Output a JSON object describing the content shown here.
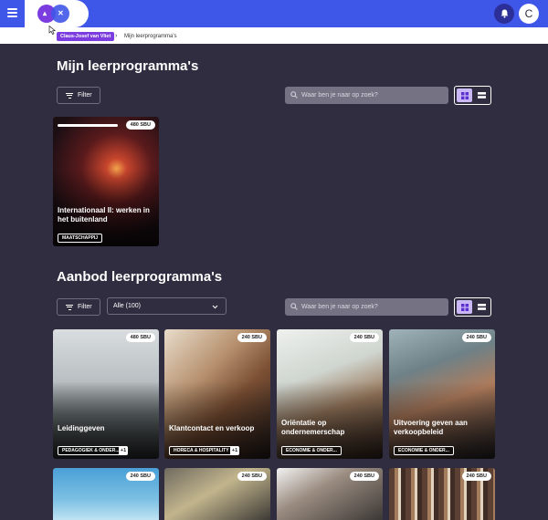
{
  "user": {
    "avatar_initial": "C",
    "name_chip": "Claus-Josef van Vliet"
  },
  "breadcrumb": {
    "separator": "›",
    "current": "Mijn leerprogramma's"
  },
  "mine": {
    "title": "Mijn leerprogramma's",
    "filter_label": "Filter",
    "search_placeholder": "Waar ben je naar op zoek?",
    "cards": [
      {
        "sbu": "480 SBU",
        "title": "Internationaal II: werken in het buitenland",
        "tag": "MAATSCHAPPIJ",
        "progress": 0.6
      }
    ]
  },
  "offer": {
    "title": "Aanbod leerprogramma's",
    "filter_label": "Filter",
    "select_value": "Alle (100)",
    "search_placeholder": "Waar ben je naar op zoek?",
    "cards": [
      {
        "sbu": "480 SBU",
        "title": "Leidinggeven",
        "tag": "PEDAGOGIEK & ONDER...",
        "more": "+1"
      },
      {
        "sbu": "240 SBU",
        "title": "Klantcontact en verkoop",
        "tag": "HORECA & HOSPITALITY",
        "more": "+1"
      },
      {
        "sbu": "240 SBU",
        "title": "Oriëntatie op ondernemerschap",
        "tag": "ECONOMIE & ONDER..."
      },
      {
        "sbu": "240 SBU",
        "title": "Uitvoering geven aan verkoopbeleid",
        "tag": "ECONOMIE & ONDER..."
      },
      {
        "sbu": "240 SBU"
      },
      {
        "sbu": "240 SBU"
      },
      {
        "sbu": "240 SBU"
      },
      {
        "sbu": "240 SBU"
      }
    ]
  },
  "colors": {
    "topbar": "#3f57e8",
    "background": "#2f2d3f",
    "accent_purple": "#7b3de0"
  },
  "icons": [
    "menu-icon",
    "logo-icon",
    "bell-icon",
    "filter-icon",
    "search-icon",
    "grid-view-icon",
    "list-view-icon",
    "chevron-down-icon",
    "cursor-icon"
  ]
}
